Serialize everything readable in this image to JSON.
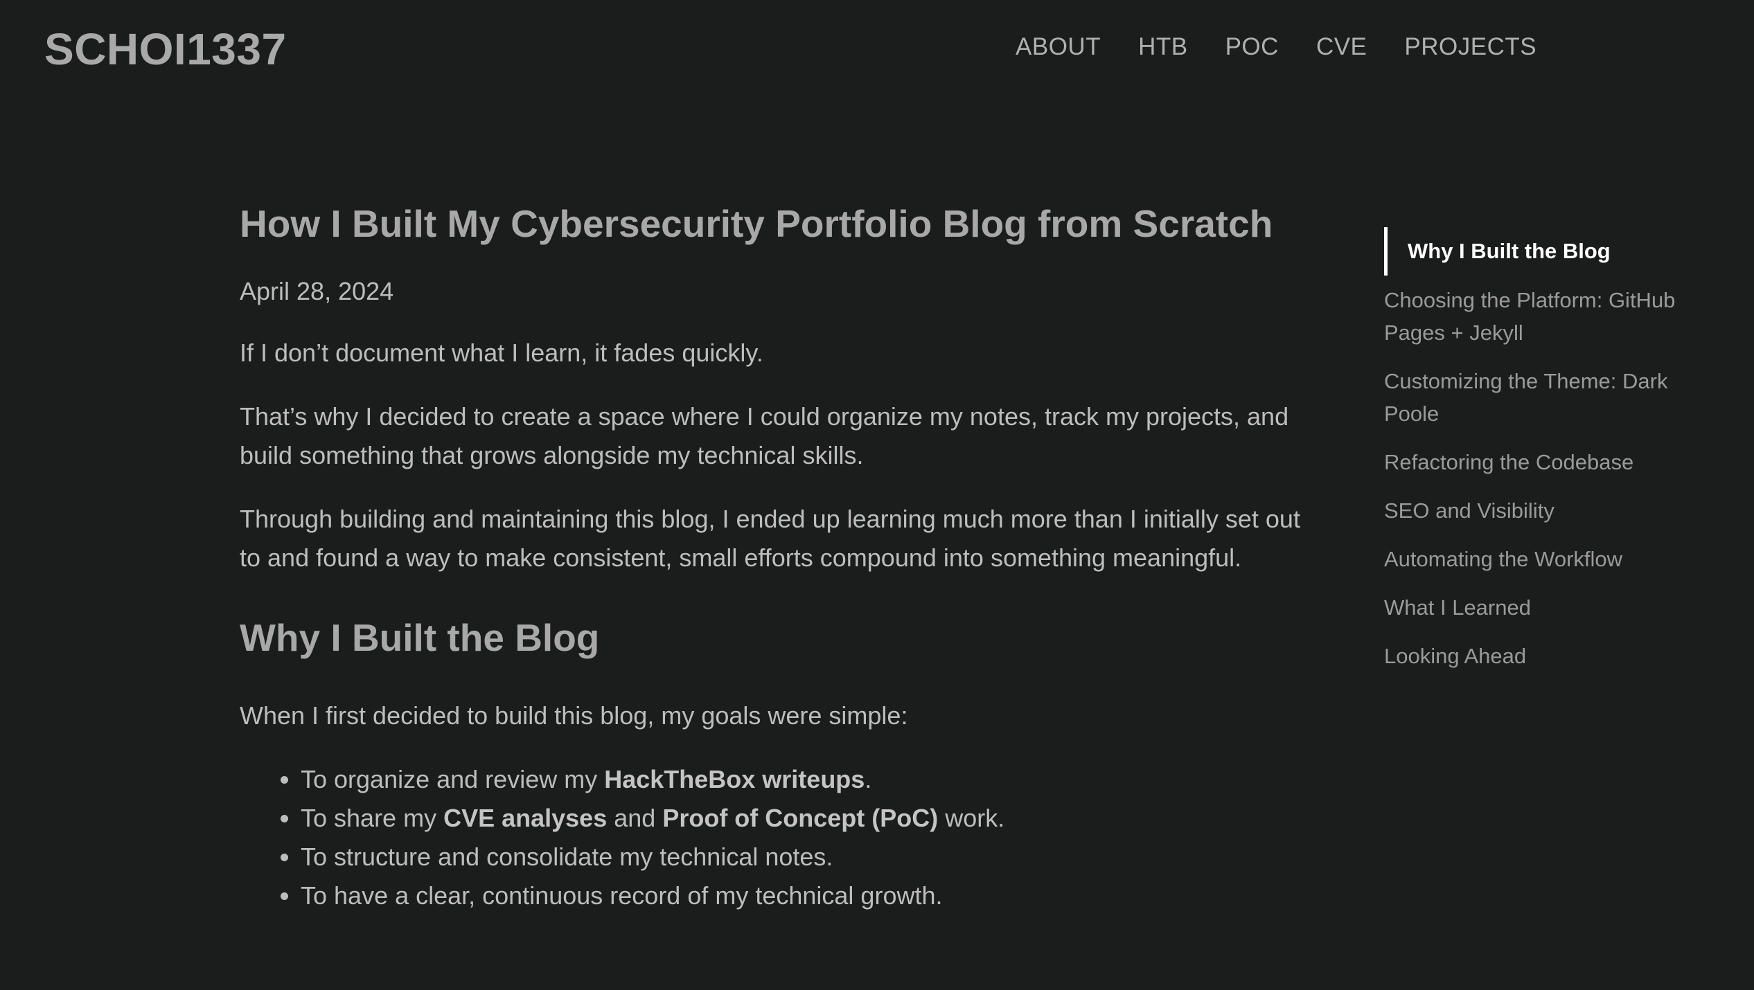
{
  "header": {
    "site_title": "SCHOI1337",
    "nav": [
      "ABOUT",
      "HTB",
      "POC",
      "CVE",
      "PROJECTS"
    ]
  },
  "post": {
    "title": "How I Built My Cybersecurity Portfolio Blog from Scratch",
    "date": "April 28, 2024",
    "p1": "If I don’t document what I learn, it fades quickly.",
    "p2": "That’s why I decided to create a space where I could organize my notes, track my projects, and build something that grows alongside my technical skills.",
    "p3": "Through building and maintaining this blog, I ended up learning much more than I initially set out to and found a way to make consistent, small efforts compound into something meaningful.",
    "section_title": "Why I Built the Blog",
    "p4": "When I first decided to build this blog, my goals were simple:",
    "list": {
      "li1_pre": "To organize and review my ",
      "li1_bold": "HackTheBox writeups",
      "li1_post": ".",
      "li2_pre": "To share my ",
      "li2_bold1": "CVE analyses",
      "li2_mid": " and ",
      "li2_bold2": "Proof of Concept (PoC)",
      "li2_post": " work.",
      "li3": "To structure and consolidate my technical notes.",
      "li4": "To have a clear, continuous record of my technical growth."
    }
  },
  "toc": [
    "Why I Built the Blog",
    "Choosing the Platform: GitHub Pages + Jekyll",
    "Customizing the Theme: Dark Poole",
    "Refactoring the Codebase",
    "SEO and Visibility",
    "Automating the Workflow",
    "What I Learned",
    "Looking Ahead"
  ]
}
